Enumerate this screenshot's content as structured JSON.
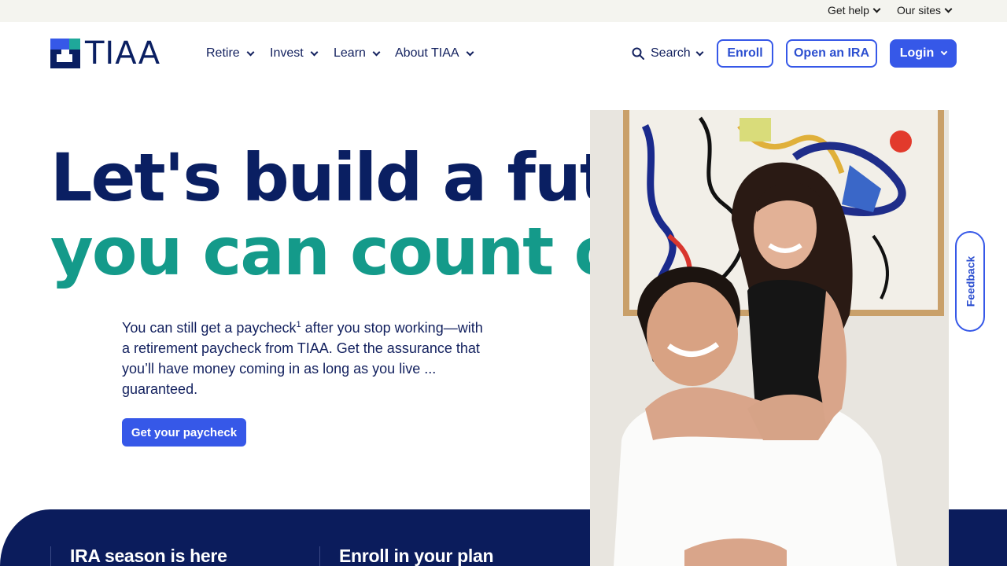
{
  "utility": {
    "get_help": "Get help",
    "our_sites": "Our sites"
  },
  "header": {
    "logo_text": "TIAA",
    "nav": [
      "Retire",
      "Invest",
      "Learn",
      "About TIAA"
    ],
    "search": "Search",
    "enroll": "Enroll",
    "open_ira": "Open an IRA",
    "login": "Login"
  },
  "hero": {
    "headline_line1": "Let's build a future",
    "headline_line2": "you can count on",
    "body_part1": "You can still get a paycheck",
    "body_sup": "1",
    "body_part2": " after you stop working—with a retirement paycheck from TIAA. Get the assurance that you’ll have money coming in as long as you live ... guaranteed.",
    "cta": "Get your paycheck"
  },
  "bottom_band": {
    "card1_title": "IRA season is here",
    "card2_title": "Enroll in your plan"
  },
  "feedback": "Feedback",
  "colors": {
    "navy": "#0a1f62",
    "teal": "#149a8a",
    "accent_blue": "#3658e8",
    "band_navy": "#0b1c5c"
  }
}
